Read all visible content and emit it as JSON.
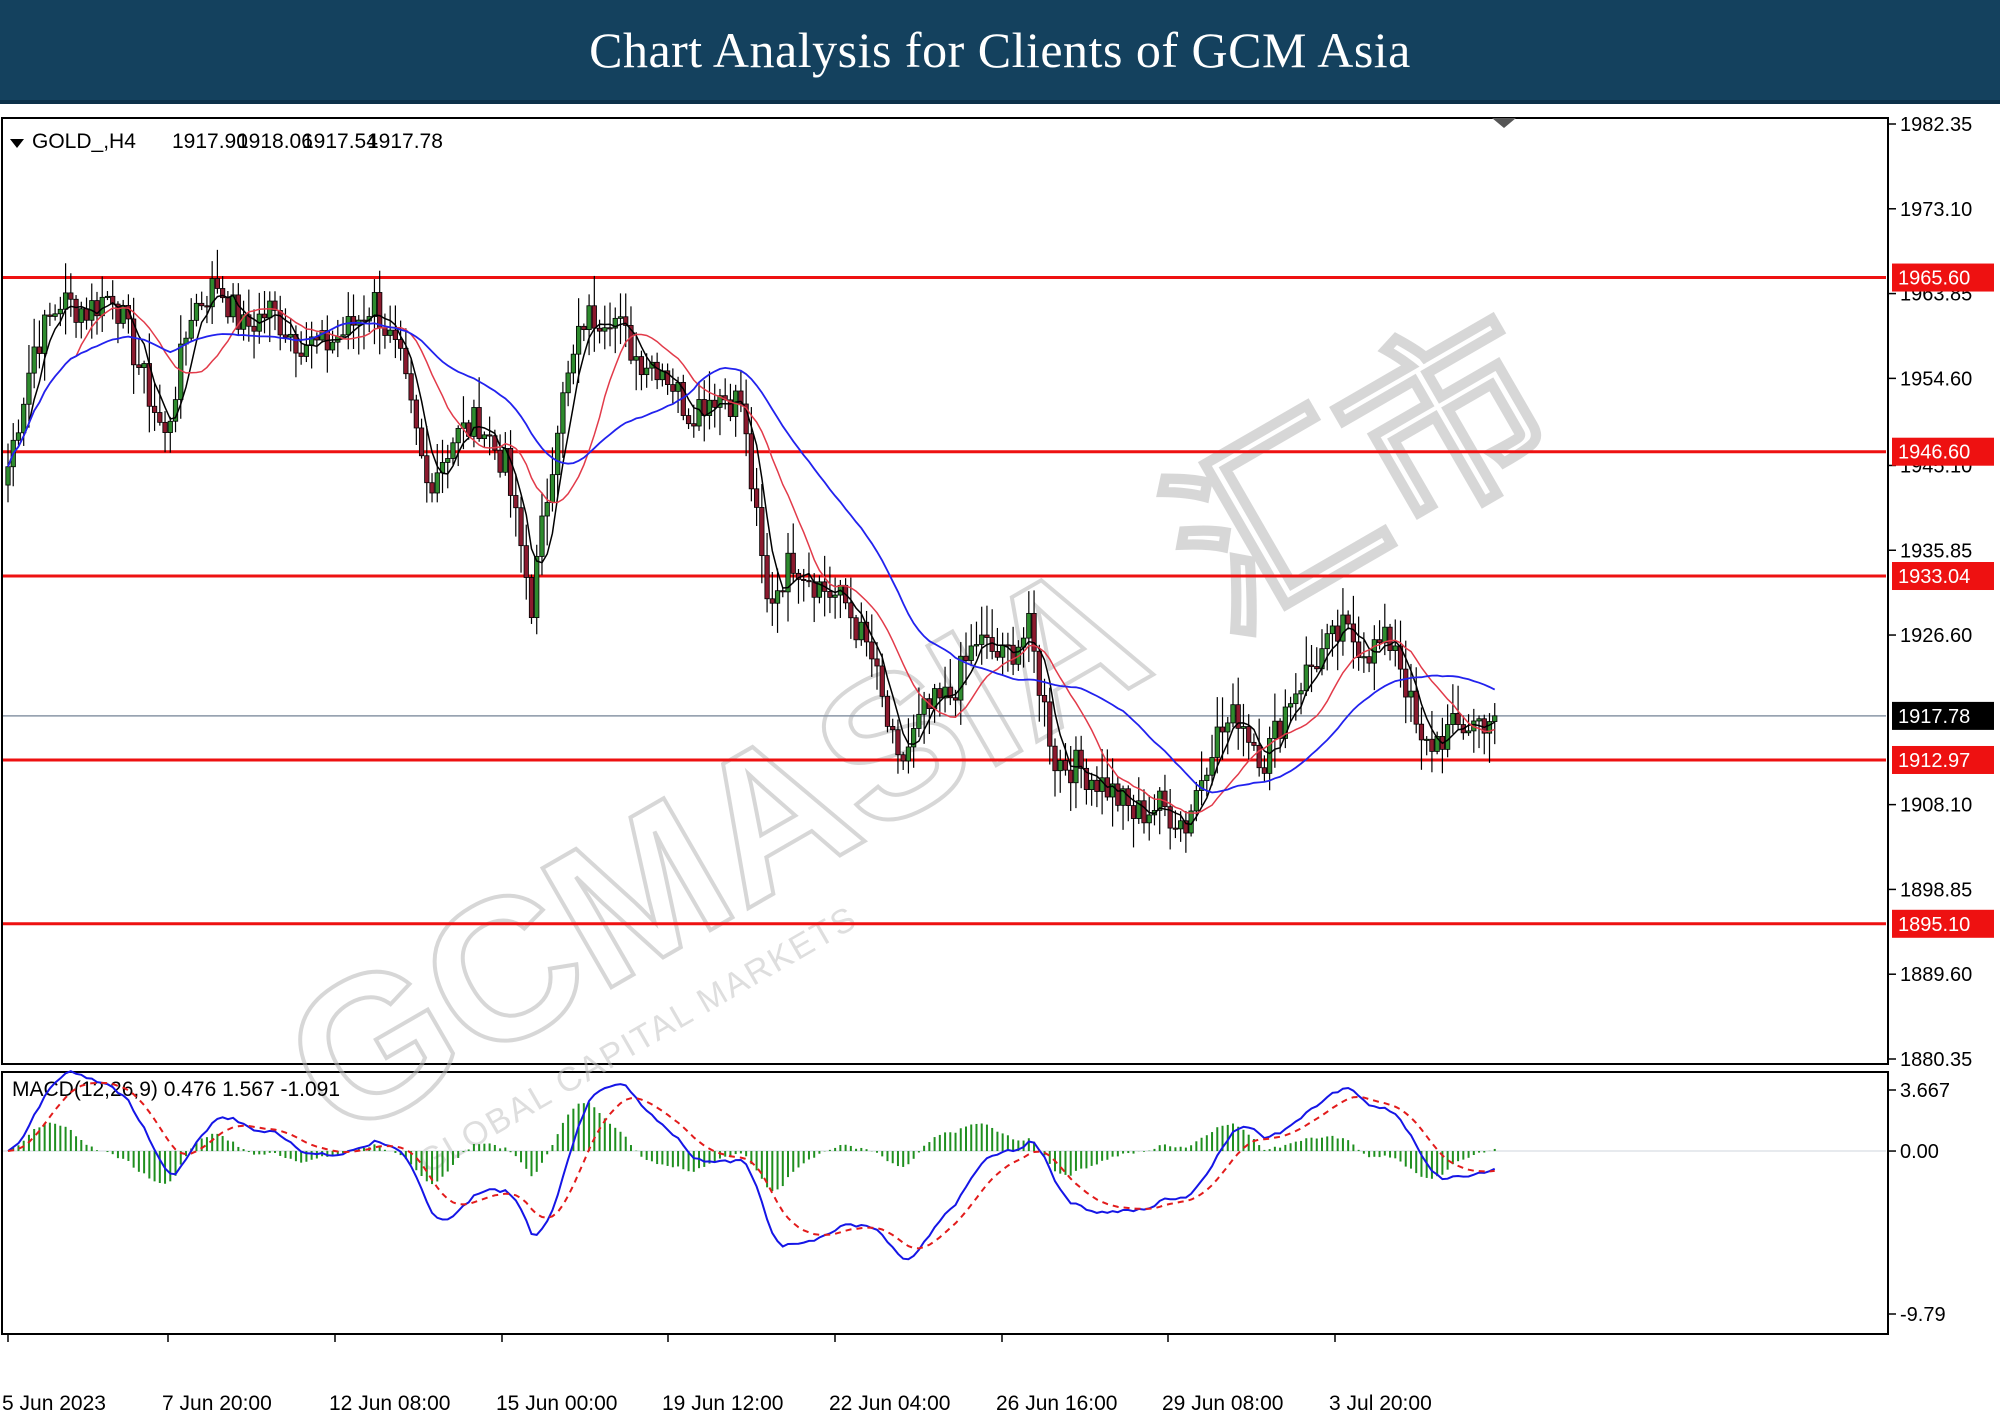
{
  "header": {
    "title": "Chart Analysis for Clients of GCM Asia"
  },
  "watermark": {
    "text": "GCMASIA",
    "cn": "汇市",
    "sub": "GLOBAL CAPITAL MARKETS"
  },
  "chart_data": [
    {
      "type": "candlestick",
      "symbol": "GOLD_,H4",
      "ohlc_readout": {
        "open": "1917.90",
        "high": "1918.06",
        "low": "1917.54",
        "close": "1917.78"
      },
      "ylim": [
        1880.35,
        1982.35
      ],
      "yticks": [
        "1982.35",
        "1973.10",
        "1963.85",
        "1954.60",
        "1945.10",
        "1935.85",
        "1926.60",
        "1908.10",
        "1898.85",
        "1889.60",
        "1880.35"
      ],
      "current_price": "1917.78",
      "levels": [
        "1965.60",
        "1946.60",
        "1933.04",
        "1912.97",
        "1895.10"
      ],
      "x_labels": [
        "5 Jun 2023",
        "7 Jun 20:00",
        "12 Jun 08:00",
        "15 Jun 00:00",
        "19 Jun 12:00",
        "22 Jun 04:00",
        "26 Jun 16:00",
        "29 Jun 08:00",
        "3 Jul 20:00"
      ],
      "colors": {
        "bull": "#2e8b2e",
        "bear": "#8b1a2e",
        "level": "#ee1111",
        "ma_fast": "#000000",
        "ma_mid": "#e23b4a",
        "ma_slow": "#2222ee"
      },
      "series": [
        {
          "name": "close",
          "x": [
            0,
            5,
            10,
            15,
            20,
            25,
            30,
            35,
            40,
            45,
            50,
            55,
            60,
            65,
            70,
            75,
            80,
            85,
            90,
            95,
            100,
            105,
            110,
            115,
            120,
            125,
            130,
            135,
            140,
            145,
            150,
            155,
            160,
            165,
            170,
            175,
            180,
            185,
            190,
            195,
            200,
            205,
            210,
            215,
            220,
            225,
            230,
            235,
            240,
            245,
            250,
            255,
            260,
            265,
            270,
            275,
            280,
            284
          ],
          "values": [
            1945,
            1958,
            1963,
            1962,
            1964,
            1956,
            1948,
            1962,
            1965,
            1960,
            1962,
            1959,
            1958,
            1960,
            1963,
            1956,
            1943,
            1948,
            1950,
            1945,
            1930,
            1950,
            1961,
            1962,
            1957,
            1956,
            1951,
            1953,
            1952,
            1930,
            1935,
            1932,
            1930,
            1924,
            1912,
            1918,
            1920,
            1926,
            1924,
            1927,
            1913,
            1912,
            1910,
            1907,
            1908,
            1906,
            1915,
            1918,
            1913,
            1920,
            1924,
            1927,
            1925,
            1926,
            1914,
            1916,
            1917,
            1917.8
          ]
        }
      ]
    },
    {
      "type": "macd",
      "label": "MACD(12,26,9) 0.476 1.567 -1.091",
      "ylim": [
        -9.79,
        3.667
      ],
      "yticks": [
        "3.667",
        "0.00",
        "-9.79"
      ]
    }
  ]
}
